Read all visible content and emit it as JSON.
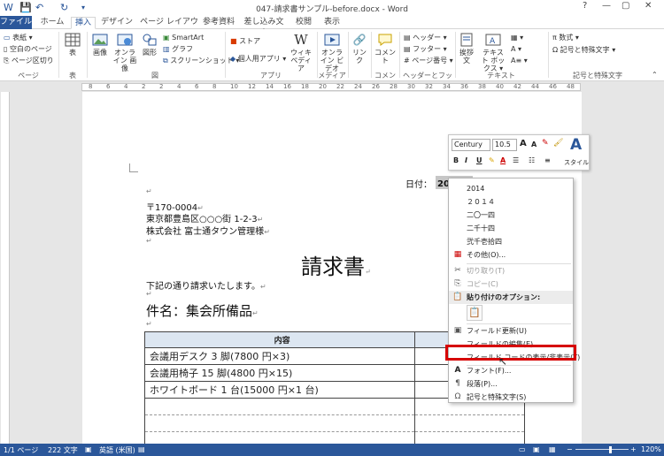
{
  "window": {
    "title": "047-請求書サンプル-before.docx - Word",
    "help": "?",
    "minimize": "—",
    "maximize": "▢",
    "close": "✕"
  },
  "quick_access": {
    "save": "💾",
    "undo": "↶",
    "redo": "↻",
    "customize": "▾"
  },
  "tabs": [
    "ファイル",
    "ホーム",
    "挿入",
    "デザイン",
    "ページ レイアウト",
    "参考資料",
    "差し込み文書",
    "校閲",
    "表示"
  ],
  "active_tab": "挿入",
  "ribbon": {
    "pages": {
      "cover": "表紙 ▾",
      "blank": "空白のページ",
      "break": "ページ区切り",
      "label": "ページ"
    },
    "table": {
      "table": "表",
      "label": "表"
    },
    "illustrations": {
      "picture": "画像",
      "online_picture": "オンライン 画像",
      "shapes": "図形",
      "smartart": "SmartArt",
      "chart": "グラフ",
      "screenshot": "スクリーンショット ▾",
      "label": "図"
    },
    "apps": {
      "store": "ストア",
      "my_apps": "個人用アプリ ▾",
      "wikipedia": "ウィキ ペディア",
      "label": "アプリ"
    },
    "media": {
      "online_video": "オンライン ビデオ",
      "label": "メディア"
    },
    "links": {
      "link": "リンク",
      "label": ""
    },
    "comments": {
      "comment": "コメント",
      "label": "コメント"
    },
    "header_footer": {
      "header": "ヘッダー ▾",
      "footer": "フッター ▾",
      "page_number": "ページ番号 ▾",
      "label": "ヘッダーとフッター"
    },
    "text": {
      "greeting": "挨拶文",
      "textbox": "テキスト ボックス ▾",
      "label": "テキスト"
    },
    "symbols": {
      "equation": "数式 ▾",
      "symbol": "記号と特殊文字 ▾",
      "label": "記号と特殊文字"
    }
  },
  "ruler_numbers": [
    "8",
    "6",
    "4",
    "2",
    "2",
    "4",
    "6",
    "8",
    "10",
    "12",
    "14",
    "16",
    "18",
    "20",
    "22",
    "24",
    "26",
    "28",
    "30",
    "32",
    "34",
    "36",
    "38",
    "40",
    "42",
    "44",
    "46",
    "48"
  ],
  "document": {
    "date_label": "日付：",
    "date_value": "2014年",
    "postal": "〒170-0004",
    "address": "東京都豊島区○○○街 1-2-3",
    "recipient": "株式会社 富士通タウン管理様",
    "heading": "請求書",
    "intro": "下記の通り請求いたします。",
    "subject": "件名：集会所備品",
    "para_mark": "↵",
    "table_header": "内容",
    "rows": [
      "会議用デスク 3 脚(7800 円×3)",
      "会議用椅子 15 脚(4800 円×15)",
      "ホワイトボード 1 台(15000 円×1 台)",
      "",
      "",
      ""
    ]
  },
  "mini_toolbar": {
    "font": "Century",
    "size": "10.5",
    "grow": "A",
    "shrink": "A",
    "style": "スタイル",
    "bold": "B",
    "italic": "I",
    "underline": "U"
  },
  "context_menu": {
    "items": [
      {
        "label": "2014",
        "disabled": false
      },
      {
        "label": "２０１４",
        "disabled": false
      },
      {
        "label": "二〇一四",
        "disabled": false
      },
      {
        "label": "二千十四",
        "disabled": false
      },
      {
        "label": "弐千壱拾四",
        "disabled": false
      },
      {
        "label": "その他(O)...",
        "disabled": false
      },
      {
        "label": "切り取り(T)",
        "disabled": true
      },
      {
        "label": "コピー(C)",
        "disabled": true
      },
      {
        "label": "貼り付けのオプション:",
        "disabled": false
      },
      {
        "label": "フィールド更新(U)",
        "disabled": false
      },
      {
        "label": "フィールドの編集(E)...",
        "disabled": false
      },
      {
        "label": "フィールド コードの表示/非表示(T)",
        "disabled": false
      },
      {
        "label": "フォント(F)...",
        "disabled": false
      },
      {
        "label": "段落(P)...",
        "disabled": false
      },
      {
        "label": "記号と特殊文字(S)",
        "disabled": false
      }
    ]
  },
  "status": {
    "page": "1/1 ページ",
    "words": "222 文字",
    "language": "英語 (米国)",
    "zoom": "120%"
  },
  "colors": {
    "accent": "#2b579a",
    "highlight": "#d60000",
    "table_header": "#dce6f1"
  }
}
